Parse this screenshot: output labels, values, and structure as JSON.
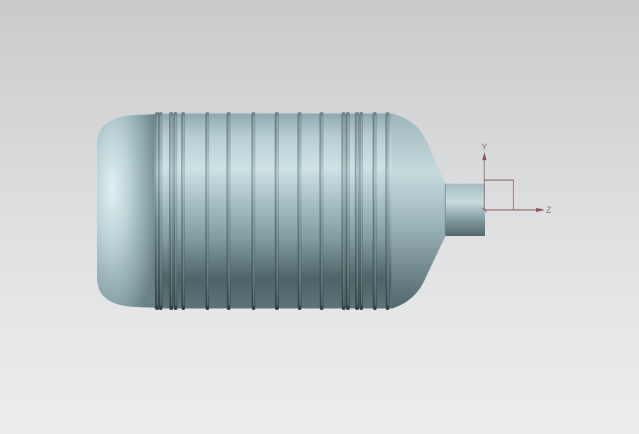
{
  "viewport": {
    "background_top": "#c9cacc",
    "background_bottom": "#ecedef"
  },
  "model": {
    "body_color": "#9fb9be",
    "highlight_color": "#dcecef",
    "shadow_color": "#3f5256"
  },
  "triad": {
    "color": "#8b5656",
    "y_label": "Y",
    "z_label": "Z"
  }
}
